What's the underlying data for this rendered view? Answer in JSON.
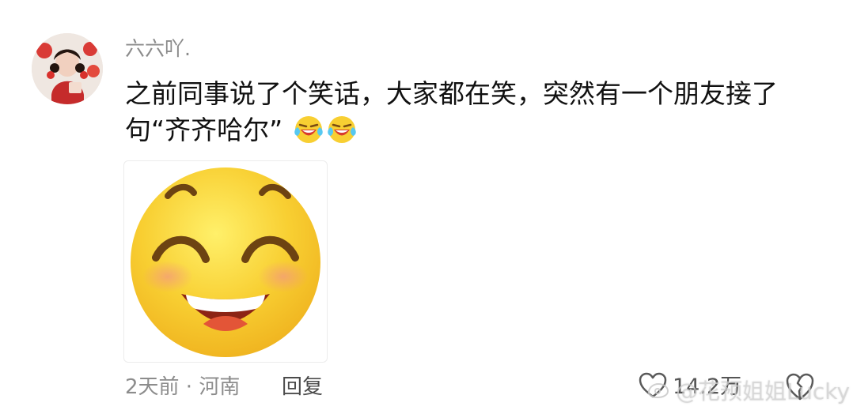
{
  "comment": {
    "username": "六六吖.",
    "text": "之前同事说了个笑话，大家都在笑，突然有一个朋友接了句“齐齐哈尔”",
    "inline_emojis": [
      "laughing-tears-emoji",
      "laughing-tears-emoji"
    ],
    "sticker": {
      "icon": "big-smile-emoji"
    },
    "meta": {
      "time": "2天前",
      "separator": " · ",
      "location": "河南"
    },
    "reply_label": "回复",
    "like_count": "14.2万"
  },
  "watermark": {
    "text": "@花预姐姐Lucky"
  },
  "colors": {
    "username": "#8b8b8b",
    "body_text": "#111111",
    "meta_text": "#8c8c8c",
    "emoji_yellow": "#f8cf32"
  }
}
